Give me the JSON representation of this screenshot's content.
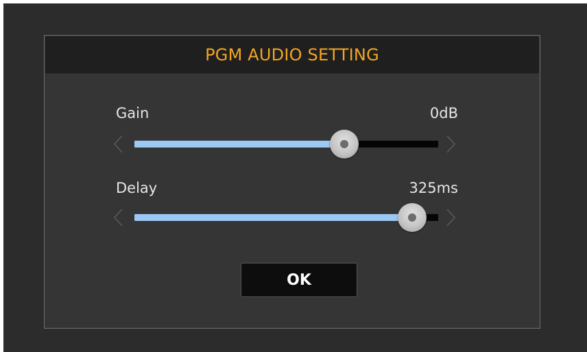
{
  "dialog": {
    "title": "PGM AUDIO SETTING",
    "ok_label": "OK"
  },
  "gain": {
    "label": "Gain",
    "value": "0dB",
    "fill_fraction": 0.69
  },
  "delay": {
    "label": "Delay",
    "value": "325ms",
    "fill_fraction": 0.915
  },
  "colors": {
    "title": "#f3a623",
    "slider_fill": "#9cc8f4",
    "background": "#2c2c2c"
  }
}
